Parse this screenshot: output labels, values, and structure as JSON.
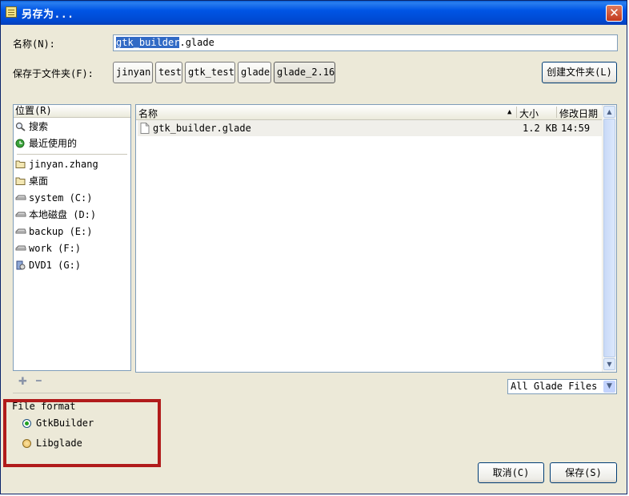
{
  "window": {
    "title": "另存为..."
  },
  "name_field": {
    "label": "名称(N):",
    "value_selected": "gtk_builder",
    "value_rest": ".glade"
  },
  "save_in": {
    "label": "保存于文件夹(F):",
    "crumbs": [
      "jinyan",
      "test",
      "gtk_test",
      "glade",
      "glade_2.16"
    ],
    "create_folder_label": "创建文件夹(L)"
  },
  "places": {
    "header": "位置(R)",
    "items": [
      {
        "label": "搜索",
        "icon": "search-icon"
      },
      {
        "label": "最近使用的",
        "icon": "recent-icon"
      },
      {
        "label": "jinyan.zhang",
        "icon": "folder-icon"
      },
      {
        "label": "桌面",
        "icon": "folder-icon"
      },
      {
        "label": "system (C:)",
        "icon": "drive-icon"
      },
      {
        "label": "本地磁盘 (D:)",
        "icon": "drive-icon"
      },
      {
        "label": "backup (E:)",
        "icon": "drive-icon"
      },
      {
        "label": "work (F:)",
        "icon": "drive-icon"
      },
      {
        "label": "DVD1 (G:)",
        "icon": "dvd-icon"
      }
    ],
    "add_symbol": "✚",
    "remove_symbol": "━"
  },
  "files": {
    "columns": {
      "name": "名称",
      "size": "大小",
      "modified": "修改日期"
    },
    "sort_indicator": "▲",
    "rows": [
      {
        "name": "gtk_builder.glade",
        "size": "1.2 KB",
        "modified": "14:59"
      }
    ]
  },
  "filter": {
    "value": "All Glade Files"
  },
  "file_format": {
    "label": "File format",
    "options": [
      {
        "label": "GtkBuilder",
        "selected": true
      },
      {
        "label": "Libglade",
        "selected": false
      }
    ]
  },
  "buttons": {
    "cancel": "取消(C)",
    "save": "保存(S)"
  },
  "colors": {
    "titlebar": "#0055e5",
    "dialog_bg": "#ece9d8",
    "selection": "#316ac5",
    "highlight_box": "#b11b1b"
  }
}
